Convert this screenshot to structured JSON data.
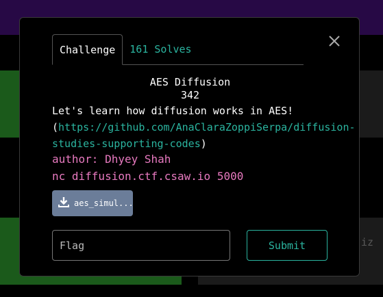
{
  "background": {
    "partial_text": "iz"
  },
  "modal": {
    "tabs": [
      {
        "label": "Challenge",
        "active": true
      },
      {
        "label": "161 Solves",
        "active": false
      }
    ],
    "title": "AES Diffusion",
    "points": "342",
    "description_intro": "Let's learn how diffusion works in AES!",
    "link_open": "(",
    "link_url": "https://github.com/AnaClaraZoppiSerpa/diffusion-studies-supporting-codes",
    "link_close": ")",
    "author": "author: Dhyey Shah",
    "connection": "nc diffusion.ctf.csaw.io 5000",
    "file_label": "aes_simul...",
    "flag_placeholder": "Flag",
    "submit_label": "Submit"
  },
  "colors": {
    "accent": "#2bb5a0",
    "pink": "#e87ac0",
    "topbar": "#3d0f6b",
    "green_card": "#2a8a2a",
    "file_button": "#6b7d99"
  },
  "icons": {
    "close": "close-icon",
    "download": "download-icon"
  }
}
